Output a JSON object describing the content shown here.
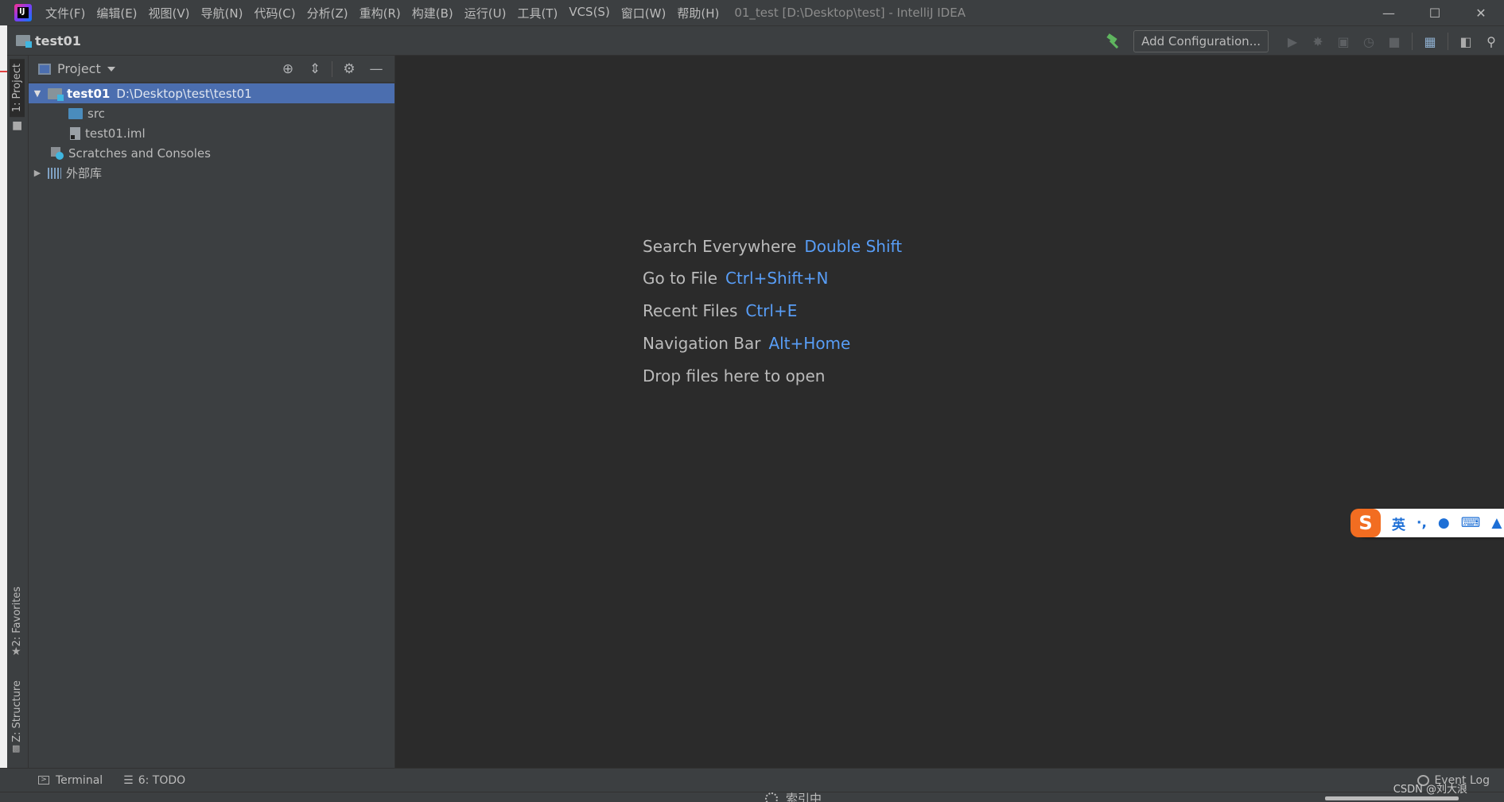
{
  "menu": [
    "文件(F)",
    "编辑(E)",
    "视图(V)",
    "导航(N)",
    "代码(C)",
    "分析(Z)",
    "重构(R)",
    "构建(B)",
    "运行(U)",
    "工具(T)",
    "VCS(S)",
    "窗口(W)",
    "帮助(H)"
  ],
  "window_title": "01_test [D:\\Desktop\\test] - IntelliJ IDEA",
  "navbar": {
    "project": "test01",
    "add_configuration": "Add Configuration..."
  },
  "left_strip": {
    "project_tab": "1: Project",
    "favorites_tab": "2: Favorites",
    "structure_tab": "Z: Structure"
  },
  "project_panel": {
    "title": "Project",
    "tree": {
      "root_name": "test01",
      "root_path": "D:\\Desktop\\test\\test01",
      "src": "src",
      "iml": "test01.iml",
      "scratches": "Scratches and Consoles",
      "external_libs": "外部库"
    }
  },
  "editor": {
    "hints": [
      {
        "label": "Search Everywhere",
        "key": "Double Shift"
      },
      {
        "label": "Go to File",
        "key": "Ctrl+Shift+N"
      },
      {
        "label": "Recent Files",
        "key": "Ctrl+E"
      },
      {
        "label": "Navigation Bar",
        "key": "Alt+Home"
      },
      {
        "label": "Drop files here to open",
        "key": ""
      }
    ]
  },
  "ime": {
    "logo": "S",
    "mode": "英"
  },
  "bottom_tools": {
    "terminal": "Terminal",
    "todo": "6: TODO",
    "event_log": "Event Log"
  },
  "status": {
    "indexing": "索引中"
  },
  "watermark": "CSDN @刘大浪",
  "colors": {
    "background": "#2b2b2b",
    "panel": "#3c3f41",
    "selection": "#4b6eaf",
    "shortcut": "#589df6",
    "build_green": "#5fb55f"
  }
}
